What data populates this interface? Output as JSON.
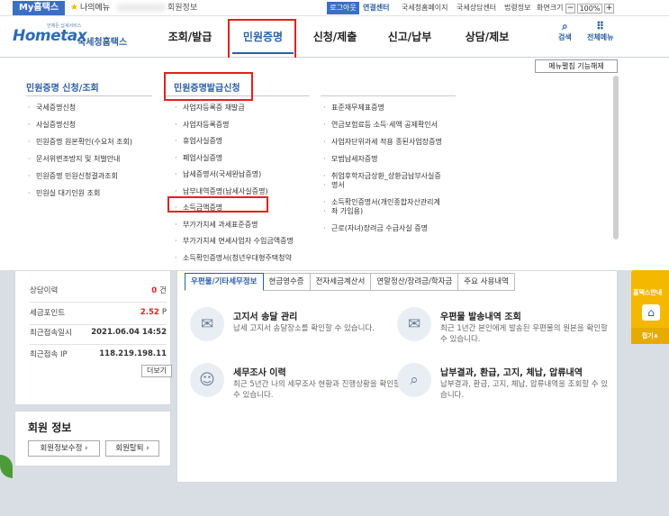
{
  "topbar": {
    "my_tab": "My홈택스",
    "fav_label": "나의메뉴",
    "user_info": "회원정보",
    "logout": "로그아웃",
    "links": [
      "연결센터",
      "국세청홈페이지",
      "국세상담센터",
      "법령정보",
      "화면크기"
    ],
    "zoom_minus": "−",
    "zoom_value": "100%",
    "zoom_plus": "+"
  },
  "header": {
    "logo_top": "언제든 납세서비스",
    "logo_main": "Hometax",
    "logo_kr": "국세청홈택스",
    "nav": [
      "조회/발급",
      "민원증명",
      "신청/제출",
      "신고/납부",
      "상담/제보"
    ],
    "active_nav": "민원증명",
    "search_label": "검색",
    "allmenu_label": "전체메뉴"
  },
  "mega": {
    "fix_button": "메뉴펼침 기능해제",
    "col1_title": "민원증명 신청/조회",
    "col1_items": [
      "국세증명신청",
      "사실증명신청",
      "민원증명 원본확인(수요처 조회)",
      "문서위변조방지 및 처벌안내",
      "민원증명 민원신청결과조회",
      "민원실 대기인원 조회"
    ],
    "col2_title": "민원증명발급신청",
    "col2_items": [
      "사업자등록증 재발급",
      "사업자등록증명",
      "휴업사실증명",
      "폐업사실증명",
      "납세증명서(국세완납증명)",
      "납부내역증명(납세사실증명)",
      "소득금액증명",
      "부가가치세 과세표준증명",
      "부가가치세 면세사업자 수입금액증명",
      "소득확인증명서(청년우대형주택청약"
    ],
    "col3_items": [
      [
        "표준재무제표증명"
      ],
      [
        "연금보험료등 소득·세액 공제확인서"
      ],
      [
        "사업자단위과세 적용 종된사업장증명"
      ],
      [
        "모범납세자증명"
      ],
      [
        "취업후학자금상환_상환금납부사실증",
        "명서"
      ],
      [
        "소득확인증명서(개인종합자산관리계",
        "좌 가입용)"
      ],
      [
        "근로(자녀)장려금 수급사실 증명"
      ]
    ]
  },
  "left": {
    "stats": [
      {
        "label": "상담이력",
        "value": "0",
        "unit": "건",
        "red": true
      },
      {
        "label": "세금포인트",
        "value": "2.52",
        "unit": "P",
        "red": true
      },
      {
        "label": "최근접속일시",
        "value": "2021.06.04 14:52",
        "unit": "",
        "red": false
      },
      {
        "label": "최근접속 IP",
        "value": "118.219.198.11",
        "unit": "",
        "red": false
      }
    ],
    "more": "더보기"
  },
  "member": {
    "title": "회원 정보",
    "edit": "회원정보수정 ›",
    "leave": "회원탈퇴 ›"
  },
  "main": {
    "tabs": [
      "우편물/기타세무정보",
      "현금영수증",
      "전자세금계산서",
      "연말정산/장려금/학자금",
      "주요 사용내역"
    ],
    "services": [
      {
        "title": "고지서 송달 관리",
        "desc": "납세 고지서 송달장소를 확인할 수 있습니다.",
        "icon": "✉"
      },
      {
        "title": "우편물 발송내역 조회",
        "desc": "최근 1년간 본인에게 발송된 우편물의 원본을 확인할 수 있습니다.",
        "icon": "✉"
      },
      {
        "title": "세무조사 이력",
        "desc": "최근 5년간 나의 세무조사 현황과 진행상황을 확인할 수 있습니다.",
        "icon": "☺"
      },
      {
        "title": "납부결과, 환급, 고지, 체납, 압류내역",
        "desc": "납부결과, 환급, 고지, 체납, 압류내역을 조회할 수 있습니다.",
        "icon": "⌕"
      }
    ]
  },
  "side": {
    "label": "홈택스안내",
    "fold": "접기∧"
  }
}
